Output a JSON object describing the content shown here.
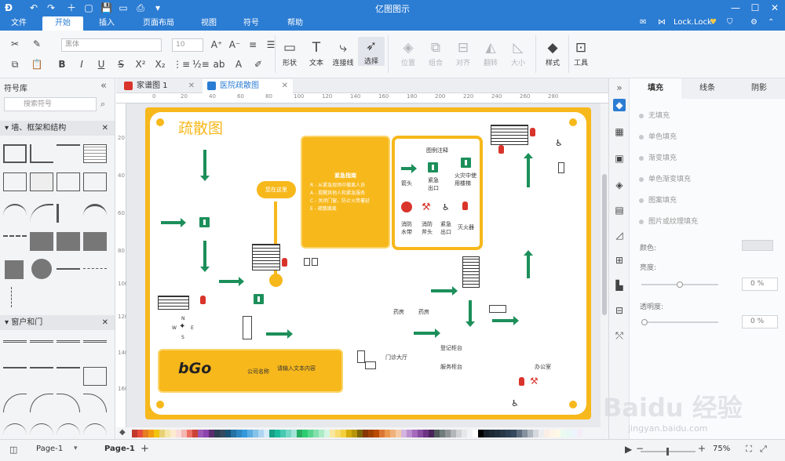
{
  "app": {
    "title": "亿图图示"
  },
  "window_controls": {
    "minimize": "—",
    "maximize": "☐",
    "close": "✕"
  },
  "quick_access": [
    "↶",
    "↷",
    "＋",
    "▢",
    "💾",
    "▭",
    "⎙",
    "▾"
  ],
  "menu": {
    "tabs": [
      "文件",
      "开始",
      "插入",
      "页面布局",
      "视图",
      "符号",
      "帮助"
    ],
    "active": "开始"
  },
  "account": {
    "user": "Lock.Lock"
  },
  "ribbon": {
    "font_family": "黑体",
    "font_size": "10",
    "groups": {
      "shape": "形状",
      "text": "文本",
      "connector": "连接线",
      "select": "选择",
      "position": "位置",
      "combine": "组合",
      "align": "对齐",
      "rotate": "翻转",
      "size": "大小",
      "style": "样式",
      "tools": "工具"
    }
  },
  "left_panel": {
    "title": "符号库",
    "search_placeholder": "搜索符号",
    "categories": [
      "墙、框架和结构",
      "窗户和门"
    ]
  },
  "doc_tabs": [
    {
      "label": "家谱图 1",
      "active": false,
      "color": "#d9342b"
    },
    {
      "label": "医院疏散图",
      "active": true,
      "color": "#2b7cd3"
    }
  ],
  "ruler_ticks": [
    "0",
    "20",
    "40",
    "60",
    "80",
    "100",
    "120",
    "140",
    "160",
    "180",
    "200",
    "220",
    "240",
    "260",
    "280"
  ],
  "vruler_ticks": [
    "20",
    "40",
    "60",
    "80",
    "100",
    "120",
    "140",
    "160"
  ],
  "diagram": {
    "title": "疏散图",
    "assembly_label": "您在这里",
    "emergency_box": {
      "title": "紧急指南",
      "lines": [
        "R - 从紧急现场中撤离人员",
        "A - 提醒其他人和紧急服务",
        "C - 关闭门窗，防止火势蔓延",
        "E - 疏散撤离"
      ]
    },
    "legend": {
      "title": "图例注释",
      "items": [
        "箭头",
        "紧急出口",
        "火灾中使用楼梯",
        "消防水带",
        "消防斧头",
        "紧急出口",
        "灭火器"
      ]
    },
    "company": {
      "logo": "bGo",
      "name": "公司名称",
      "placeholder": "请输入文本内容"
    },
    "room_labels": {
      "pharmacy1": "药房",
      "pharmacy2": "药房",
      "outpatient": "门诊大厅",
      "registration": "登记柜台",
      "service": "服务柜台",
      "office": "办公室"
    },
    "compass": {
      "n": "N",
      "s": "S",
      "w": "W",
      "e": "E"
    }
  },
  "right_panel": {
    "tabs": [
      "填充",
      "线条",
      "阴影"
    ],
    "active_tab": "填充",
    "fill_options": [
      "无填充",
      "单色填充",
      "渐变填充",
      "单色渐变填充",
      "图案填充",
      "图片或纹理填充"
    ],
    "color_label": "颜色:",
    "brightness_label": "亮度:",
    "brightness_value": "0 %",
    "transparency_label": "透明度:",
    "transparency_value": "0 %"
  },
  "status": {
    "page_nav": "Page-1",
    "page_tab": "Page-1",
    "zoom": "75%"
  },
  "watermark": {
    "text": "Baidu 经验",
    "url": "jingyan.baidu.com"
  },
  "palette": [
    "#c0392b",
    "#e74c3c",
    "#e67e22",
    "#f39c12",
    "#f1c40f",
    "#e8d174",
    "#f5e6a8",
    "#fdebd0",
    "#fadbd8",
    "#f5b7b1",
    "#ec7063",
    "#cb4335",
    "#9b59b6",
    "#8e44ad",
    "#5b2c6f",
    "#2c3e50",
    "#34495e",
    "#1a5276",
    "#2471a3",
    "#2e86c1",
    "#3498db",
    "#5dade2",
    "#85c1e9",
    "#aed6f1",
    "#d6eaf8",
    "#16a085",
    "#1abc9c",
    "#48c9b0",
    "#76d7c4",
    "#a3e4d7",
    "#27ae60",
    "#2ecc71",
    "#58d68d",
    "#82e0aa",
    "#abebc6",
    "#d5f5e3",
    "#f9e79f",
    "#f7dc6f",
    "#f4d03f",
    "#d4ac0d",
    "#b7950b",
    "#7d6608",
    "#873600",
    "#a04000",
    "#ba4a00",
    "#dc7633",
    "#eb984e",
    "#f0b27a",
    "#f5cba7",
    "#d2b4de",
    "#bb8fce",
    "#a569bd",
    "#884ea0",
    "#6c3483",
    "#4a235a",
    "#515a5a",
    "#707b7c",
    "#909497",
    "#b3b6b7",
    "#d0d3d4",
    "#e5e7e9",
    "#f2f3f4",
    "#ffffff",
    "#000000",
    "#17202a",
    "#1c2833",
    "#212f3d",
    "#273746",
    "#2e4053",
    "#34495e",
    "#5d6d7e",
    "#85929e",
    "#aeb6bf",
    "#d5d8dc",
    "#ebedef",
    "#fbeee6",
    "#fef5e7",
    "#fef9e7",
    "#eafaf1",
    "#e8f8f5",
    "#ebf5fb",
    "#f4ecf7"
  ]
}
